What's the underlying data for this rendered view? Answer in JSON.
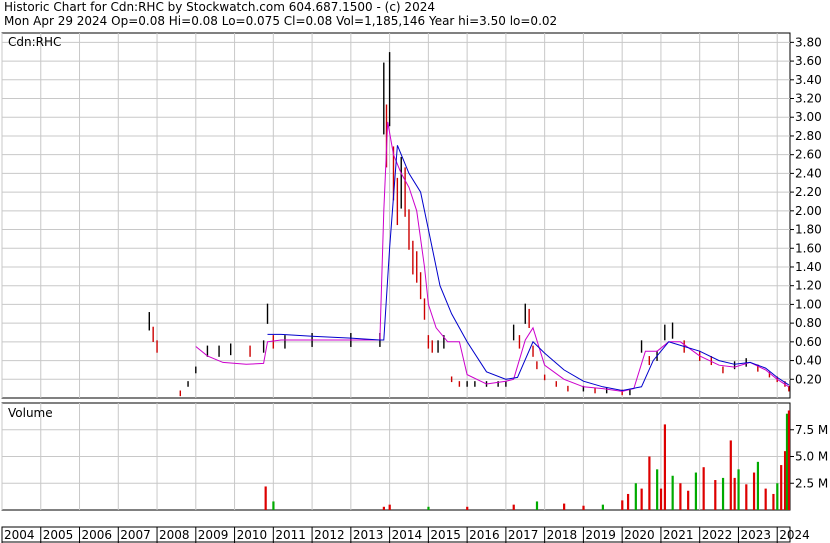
{
  "header": {
    "line1": "Historic Chart for Cdn:RHC by Stockwatch.com 604.687.1500 - (c) 2024",
    "line2": "Mon Apr 29 2024   Op=0.08   Hi=0.08   Lo=0.075   Cl=0.08   Vol=1,185,146   Year hi=3.50   lo=0.02"
  },
  "colors": {
    "price_bar": "#000000",
    "down_bar": "#cc0000",
    "ma_short": "#cc00cc",
    "ma_long": "#0000cc",
    "vol_up": "#00aa00",
    "vol_down": "#dd0000",
    "grid": "#c8c8c8"
  },
  "chart_data": [
    {
      "type": "line",
      "label": "Cdn:RHC",
      "ylim": [
        0,
        3.9
      ],
      "xlim": [
        2004,
        2024.33
      ],
      "y_ticks": [
        "0.20",
        "0.40",
        "0.60",
        "0.80",
        "1.00",
        "1.20",
        "1.40",
        "1.60",
        "1.80",
        "2.00",
        "2.20",
        "2.40",
        "2.60",
        "2.80",
        "3.00",
        "3.20",
        "3.40",
        "3.60",
        "3.80"
      ],
      "x_ticks": [
        "2004",
        "2005",
        "2006",
        "2007",
        "2008",
        "2009",
        "2010",
        "2011",
        "2012",
        "2013",
        "2014",
        "2015",
        "2016",
        "2017",
        "2018",
        "2019",
        "2020",
        "2021",
        "2022",
        "2023",
        "2024"
      ],
      "series": [
        {
          "role": "price",
          "x": [
            2007.8,
            2007.9,
            2008.0,
            2008.6,
            2008.8,
            2009.0,
            2009.3,
            2009.6,
            2009.9,
            2010.4,
            2010.75,
            2010.85,
            2011.0,
            2011.3,
            2012.0,
            2013.0,
            2013.75,
            2013.85,
            2013.92,
            2014.0,
            2014.1,
            2014.2,
            2014.3,
            2014.4,
            2014.5,
            2014.6,
            2014.7,
            2014.8,
            2014.9,
            2015.0,
            2015.1,
            2015.25,
            2015.4,
            2015.6,
            2015.8,
            2016.0,
            2016.2,
            2016.5,
            2016.8,
            2017.0,
            2017.2,
            2017.35,
            2017.5,
            2017.6,
            2017.7,
            2017.8,
            2018.0,
            2018.3,
            2018.6,
            2019.0,
            2019.3,
            2019.6,
            2020.0,
            2020.2,
            2020.5,
            2020.7,
            2020.9,
            2021.1,
            2021.3,
            2021.6,
            2022.0,
            2022.3,
            2022.6,
            2022.9,
            2023.2,
            2023.5,
            2023.8,
            2024.0,
            2024.2,
            2024.3
          ],
          "y": [
            0.82,
            0.68,
            0.55,
            0.05,
            0.15,
            0.3,
            0.5,
            0.5,
            0.52,
            0.5,
            0.55,
            0.9,
            0.6,
            0.6,
            0.62,
            0.62,
            0.62,
            3.2,
            2.8,
            3.3,
            2.4,
            2.1,
            2.3,
            2.2,
            1.8,
            1.5,
            1.4,
            1.2,
            0.95,
            0.6,
            0.55,
            0.55,
            0.6,
            0.2,
            0.15,
            0.15,
            0.15,
            0.15,
            0.15,
            0.15,
            0.7,
            0.6,
            0.9,
            0.85,
            0.5,
            0.35,
            0.22,
            0.15,
            0.1,
            0.1,
            0.08,
            0.08,
            0.06,
            0.06,
            0.55,
            0.4,
            0.45,
            0.7,
            0.72,
            0.55,
            0.45,
            0.4,
            0.3,
            0.35,
            0.38,
            0.32,
            0.25,
            0.2,
            0.15,
            0.1
          ]
        },
        {
          "role": "ma_short",
          "x": [
            2009.0,
            2009.3,
            2009.7,
            2010.3,
            2010.75,
            2010.85,
            2011.2,
            2012.0,
            2013.0,
            2013.75,
            2013.85,
            2013.95,
            2014.1,
            2014.3,
            2014.5,
            2014.7,
            2014.9,
            2015.0,
            2015.2,
            2015.5,
            2015.8,
            2016.0,
            2016.5,
            2017.0,
            2017.2,
            2017.5,
            2017.7,
            2018.0,
            2018.5,
            2019.0,
            2019.5,
            2020.0,
            2020.3,
            2020.6,
            2020.9,
            2021.2,
            2021.5,
            2022.0,
            2022.5,
            2022.9,
            2023.3,
            2023.7,
            2024.0,
            2024.3
          ],
          "y": [
            0.55,
            0.45,
            0.38,
            0.36,
            0.37,
            0.6,
            0.62,
            0.62,
            0.62,
            0.62,
            2.0,
            2.95,
            2.6,
            2.4,
            2.25,
            2.0,
            1.4,
            1.0,
            0.75,
            0.6,
            0.6,
            0.25,
            0.15,
            0.18,
            0.2,
            0.62,
            0.75,
            0.35,
            0.2,
            0.12,
            0.1,
            0.07,
            0.1,
            0.5,
            0.5,
            0.6,
            0.6,
            0.45,
            0.35,
            0.33,
            0.38,
            0.3,
            0.2,
            0.12
          ]
        },
        {
          "role": "ma_long",
          "x": [
            2010.85,
            2011.2,
            2012.0,
            2013.0,
            2013.75,
            2013.85,
            2014.0,
            2014.2,
            2014.5,
            2014.8,
            2015.0,
            2015.3,
            2015.6,
            2016.0,
            2016.5,
            2017.0,
            2017.3,
            2017.7,
            2018.0,
            2018.5,
            2019.0,
            2019.5,
            2020.0,
            2020.5,
            2020.8,
            2021.2,
            2021.6,
            2022.0,
            2022.5,
            2022.9,
            2023.3,
            2023.7,
            2024.0,
            2024.3
          ],
          "y": [
            0.68,
            0.68,
            0.66,
            0.64,
            0.62,
            0.62,
            1.6,
            2.7,
            2.4,
            2.2,
            1.8,
            1.2,
            0.9,
            0.6,
            0.28,
            0.2,
            0.22,
            0.6,
            0.48,
            0.3,
            0.18,
            0.12,
            0.08,
            0.12,
            0.4,
            0.6,
            0.55,
            0.5,
            0.4,
            0.36,
            0.38,
            0.32,
            0.22,
            0.14
          ]
        }
      ]
    },
    {
      "type": "bar",
      "label": "Volume",
      "ylim": [
        0,
        10
      ],
      "y_ticks": [
        "2.5 M",
        "5.0 M",
        "7.5 M"
      ],
      "series": [
        {
          "role": "volume",
          "x": [
            2010.8,
            2011.0,
            2013.85,
            2014.0,
            2015.0,
            2016.0,
            2017.2,
            2017.8,
            2018.5,
            2019.0,
            2019.5,
            2020.0,
            2020.15,
            2020.35,
            2020.5,
            2020.7,
            2020.9,
            2021.0,
            2021.1,
            2021.3,
            2021.5,
            2021.7,
            2021.9,
            2022.1,
            2022.4,
            2022.6,
            2022.8,
            2022.9,
            2023.0,
            2023.2,
            2023.4,
            2023.5,
            2023.7,
            2023.9,
            2024.0,
            2024.1,
            2024.2,
            2024.25,
            2024.3
          ],
          "y": [
            2.2,
            0.8,
            0.3,
            0.5,
            0.3,
            0.3,
            0.5,
            0.8,
            0.6,
            0.4,
            0.5,
            0.9,
            1.5,
            2.5,
            2.0,
            5.0,
            3.8,
            2.0,
            8.0,
            3.2,
            2.5,
            1.8,
            3.5,
            4.0,
            2.8,
            3.0,
            6.5,
            3.0,
            3.8,
            2.4,
            3.5,
            4.5,
            2.0,
            1.5,
            2.5,
            4.2,
            5.5,
            9.0,
            9.3
          ]
        }
      ]
    }
  ]
}
